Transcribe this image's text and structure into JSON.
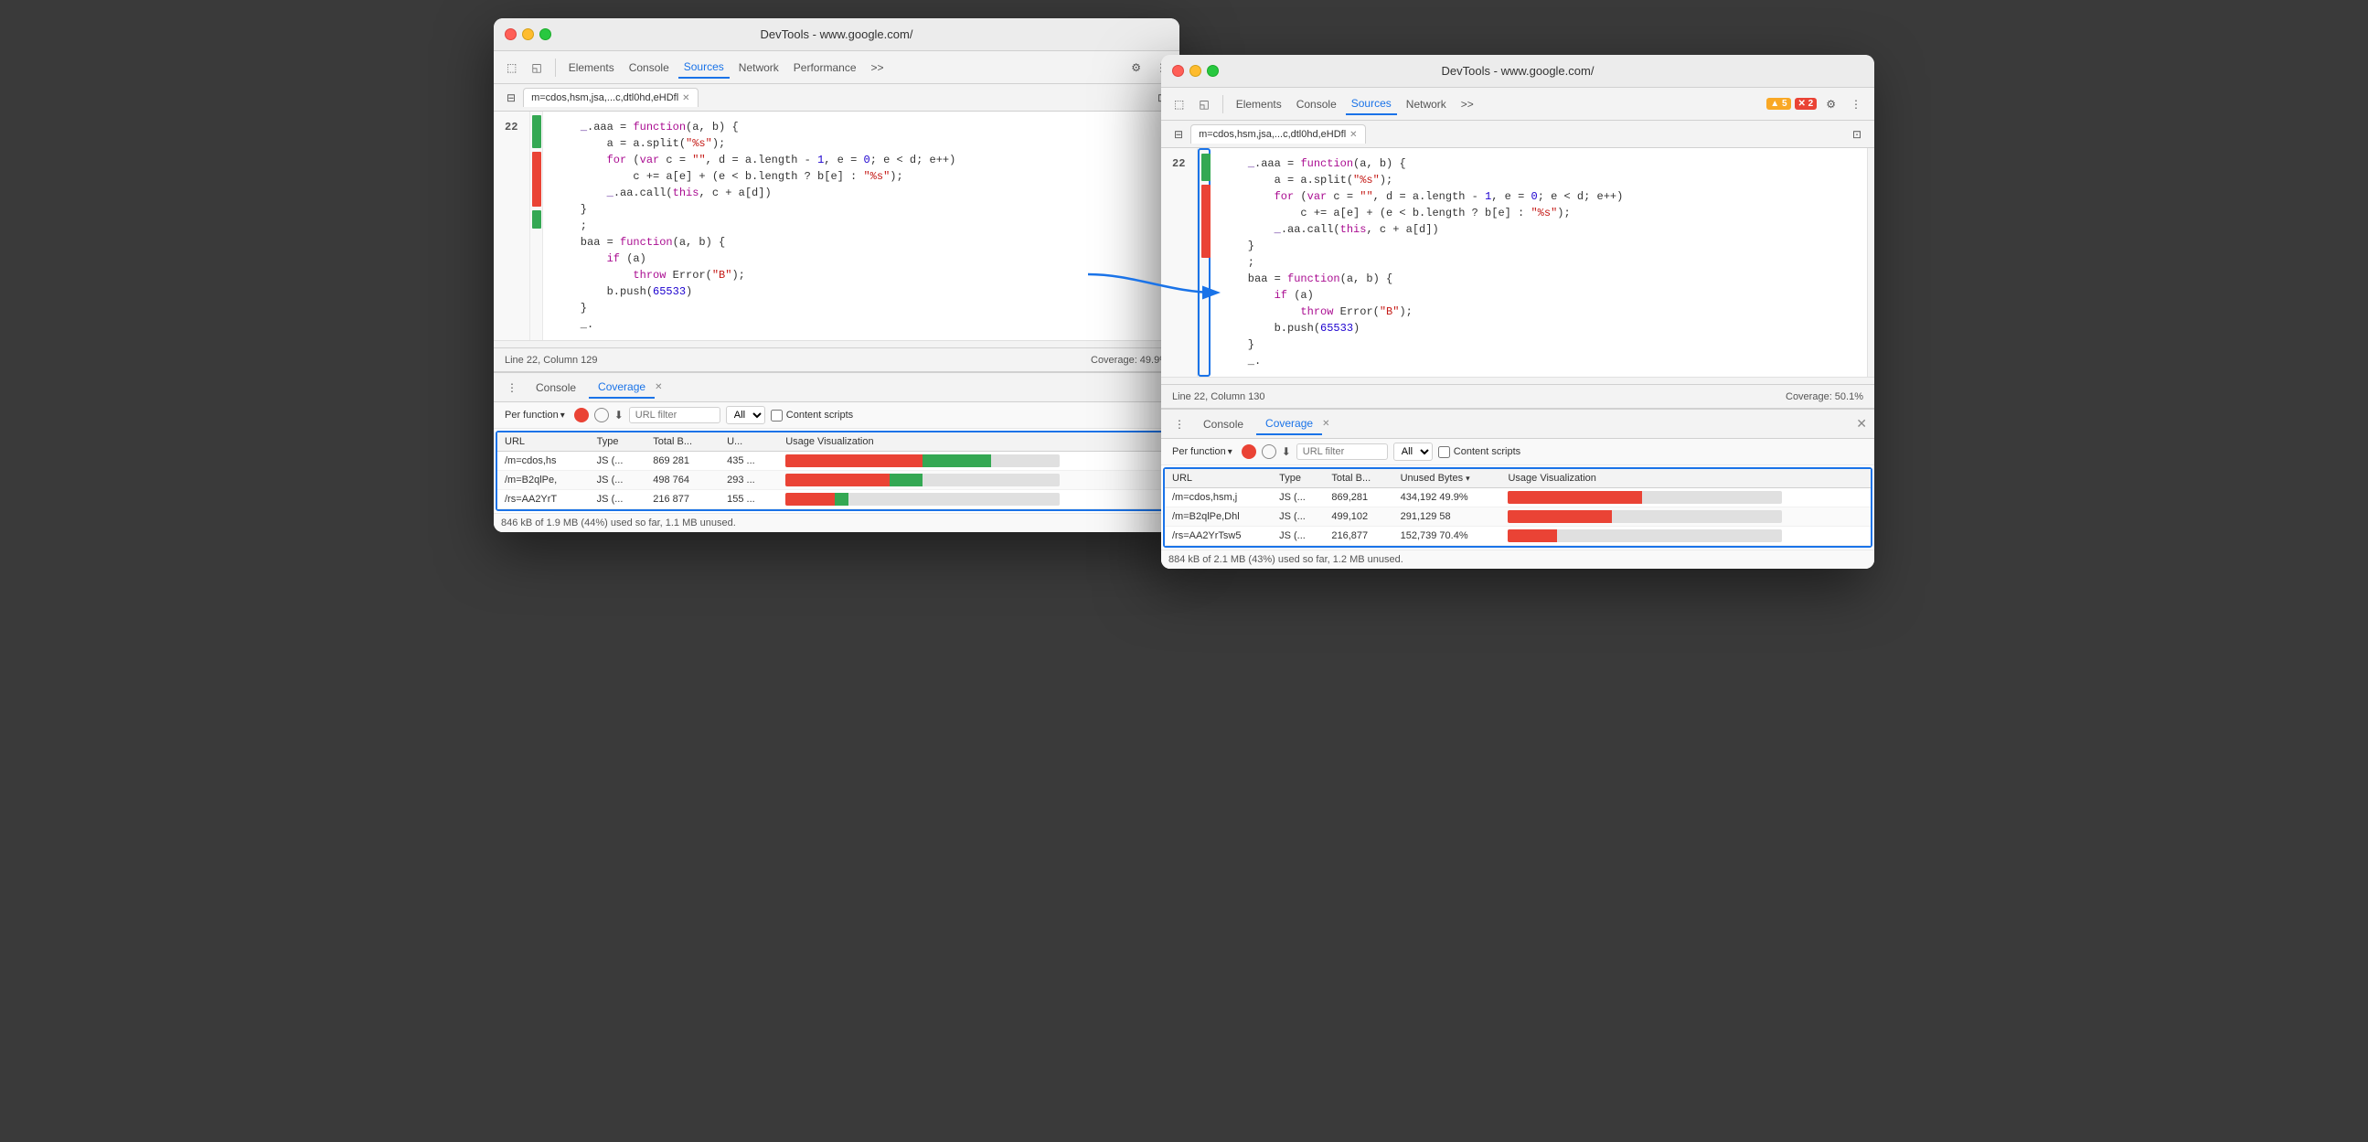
{
  "left_window": {
    "title": "DevTools - www.google.com/",
    "tabs": [
      "Elements",
      "Console",
      "Sources",
      "Network",
      "Performance",
      ">>"
    ],
    "active_tab": "Sources",
    "file_tab": "m=cdos,hsm,jsa,...c,dtl0hd,eHDfl",
    "line_col": "Line 22, Column 129",
    "coverage_pct": "Coverage: 49.9%",
    "code_lines": [
      "22",
      "",
      "",
      "",
      "",
      "",
      "",
      "",
      "",
      "",
      "",
      "",
      ""
    ],
    "code_content": [
      "            _.aaa = function(a, b) {",
      "                a = a.split(\"%s\");",
      "                for (var c = \"\", d = a.length - 1, e = 0; e < d; e++)",
      "                    c += a[e] + (e < b.length ? b[e] : \"%s\");",
      "                _.aa.call(this, c + a[d])",
      "            }",
      "            ;",
      "            baa = function(a, b) {",
      "                if (a)",
      "                    throw Error(\"B\");",
      "                b.push(65533)",
      "            }",
      "            _."
    ],
    "bottom_panel": {
      "tabs": [
        "Console",
        "Coverage"
      ],
      "active_tab": "Coverage",
      "per_function": "Per function",
      "url_filter_placeholder": "URL filter",
      "all_label": "All",
      "content_scripts_label": "Content scripts",
      "table_headers": [
        "URL",
        "Type",
        "Total B...",
        "U...",
        "Usage Visualization"
      ],
      "table_rows": [
        {
          "url": "/m=cdos,hs",
          "type": "JS (...",
          "total": "869 281",
          "unused": "435 ...",
          "used_pct": 50,
          "green_pct": 25
        },
        {
          "url": "/m=B2qlPe,",
          "type": "JS (...",
          "total": "498 764",
          "unused": "293 ...",
          "used_pct": 40,
          "green_pct": 15
        },
        {
          "url": "/rs=AA2YrT",
          "type": "JS (...",
          "total": "216 877",
          "unused": "155 ...",
          "used_pct": 18,
          "green_pct": 5
        }
      ],
      "footer": "846 kB of 1.9 MB (44%) used so far, 1.1 MB unused."
    }
  },
  "right_window": {
    "title": "DevTools - www.google.com/",
    "tabs": [
      "Elements",
      "Console",
      "Sources",
      "Network",
      ">>"
    ],
    "active_tab": "Sources",
    "warn_count": "5",
    "err_count": "2",
    "file_tab": "m=cdos,hsm,jsa,...c,dtl0hd,eHDfl",
    "line_col": "Line 22, Column 130",
    "coverage_pct": "Coverage: 50.1%",
    "code_lines": [
      "22",
      "",
      "",
      "",
      "",
      "",
      "",
      "",
      "",
      "",
      "",
      "",
      ""
    ],
    "code_content": [
      "            _.aaa = function(a, b) {",
      "                a = a.split(\"%s\");",
      "                for (var c = \"\", d = a.length - 1, e = 0; e < d; e++)",
      "                    c += a[e] + (e < b.length ? b[e] : \"%s\");",
      "                _.aa.call(this, c + a[d])",
      "            }",
      "            ;",
      "            baa = function(a, b) {",
      "                if (a)",
      "                    throw Error(\"B\");",
      "                b.push(65533)",
      "            }",
      "            _."
    ],
    "bottom_panel": {
      "tabs": [
        "Console",
        "Coverage"
      ],
      "active_tab": "Coverage",
      "per_function": "Per function",
      "url_filter_placeholder": "URL filter",
      "all_label": "All",
      "content_scripts_label": "Content scripts",
      "table_headers": [
        "URL",
        "Type",
        "Total B...",
        "Unused Bytes ▾",
        "Usage Visualization"
      ],
      "table_rows": [
        {
          "url": "/m=cdos,hsm,j",
          "type": "JS (...",
          "total": "869,281",
          "unused": "434,192",
          "pct": "49.9%",
          "used_pct": 49,
          "green_pct": 0
        },
        {
          "url": "/m=B2qlPe,Dhl",
          "type": "JS (...",
          "total": "499,102",
          "unused": "291,129",
          "pct": "58",
          "used_pct": 38,
          "green_pct": 0
        },
        {
          "url": "/rs=AA2YrTsw5",
          "type": "JS (...",
          "total": "216,877",
          "unused": "152,739",
          "pct": "70.4%",
          "used_pct": 18,
          "green_pct": 0
        }
      ],
      "footer": "884 kB of 2.1 MB (43%) used so far, 1.2 MB unused."
    }
  }
}
